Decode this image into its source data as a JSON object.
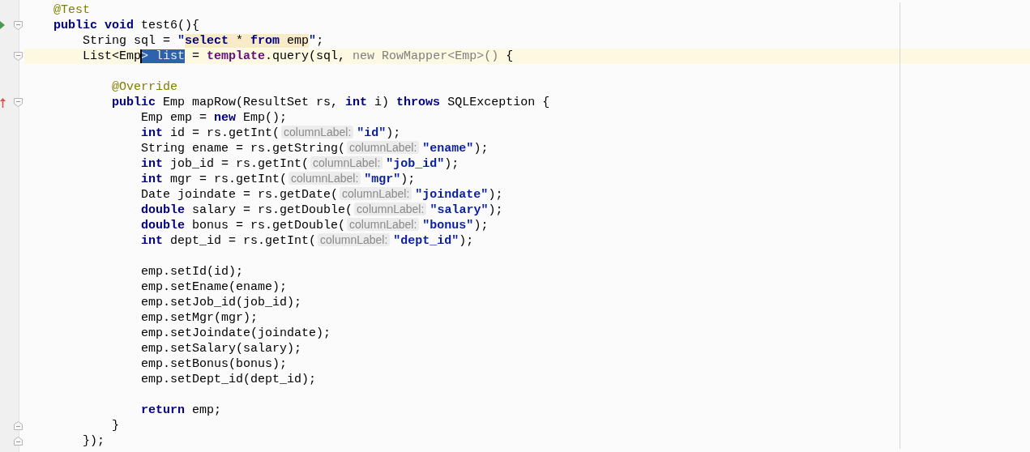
{
  "editor": {
    "lines": [
      {
        "current": false,
        "tokens": [
          {
            "kind": "annotation",
            "text": "    @Test"
          }
        ]
      },
      {
        "gutter": [
          {
            "kind": "run"
          },
          {
            "kind": "fold-start"
          }
        ],
        "current": false,
        "tokens": [
          {
            "kind": "keyword",
            "text": "    public void "
          },
          {
            "kind": "plain",
            "text": "test6(){"
          }
        ]
      },
      {
        "current": false,
        "tokens": [
          {
            "kind": "plain",
            "text": "        String sql = "
          },
          {
            "kind": "string",
            "text": "\""
          },
          {
            "kind": "sql-keyword",
            "text": "select"
          },
          {
            "kind": "sql-text",
            "text": " * "
          },
          {
            "kind": "sql-keyword",
            "text": "from"
          },
          {
            "kind": "sql-text",
            "text": " emp"
          },
          {
            "kind": "string",
            "text": "\""
          },
          {
            "kind": "plain",
            "text": ";"
          }
        ]
      },
      {
        "gutter": [
          {
            "kind": "fold-start"
          }
        ],
        "current": true,
        "tokens": [
          {
            "kind": "plain",
            "text": "        List<Emp"
          },
          {
            "kind": "selection",
            "text": "> list",
            "caret": true
          },
          {
            "kind": "plain",
            "text": " = "
          },
          {
            "kind": "field",
            "text": "template"
          },
          {
            "kind": "plain",
            "text": ".query(sql, "
          },
          {
            "kind": "unused",
            "text": "new RowMapper<Emp>()"
          },
          {
            "kind": "plain",
            "text": " {"
          }
        ]
      },
      {
        "current": false
      },
      {
        "current": false,
        "tokens": [
          {
            "kind": "annotation",
            "text": "            @Override"
          }
        ]
      },
      {
        "gutter": [
          {
            "kind": "override"
          },
          {
            "kind": "fold-start"
          }
        ],
        "current": false,
        "tokens": [
          {
            "kind": "keyword",
            "text": "            public "
          },
          {
            "kind": "plain",
            "text": "Emp mapRow(ResultSet rs, "
          },
          {
            "kind": "keyword",
            "text": "int "
          },
          {
            "kind": "plain",
            "text": "i) "
          },
          {
            "kind": "keyword",
            "text": "throws "
          },
          {
            "kind": "plain",
            "text": "SQLException {"
          }
        ]
      },
      {
        "current": false,
        "tokens": [
          {
            "kind": "plain",
            "text": "                Emp emp = "
          },
          {
            "kind": "keyword",
            "text": "new "
          },
          {
            "kind": "plain",
            "text": "Emp();"
          }
        ]
      },
      {
        "current": false,
        "tokens": [
          {
            "kind": "keyword",
            "text": "                int "
          },
          {
            "kind": "plain",
            "text": "id = rs.getInt("
          },
          {
            "kind": "hint",
            "text": "columnLabel:"
          },
          {
            "kind": "string",
            "text": "\"id\""
          },
          {
            "kind": "plain",
            "text": ");"
          }
        ]
      },
      {
        "current": false,
        "tokens": [
          {
            "kind": "plain",
            "text": "                String ename = rs.getString("
          },
          {
            "kind": "hint",
            "text": "columnLabel:"
          },
          {
            "kind": "string",
            "text": "\"ename\""
          },
          {
            "kind": "plain",
            "text": ");"
          }
        ]
      },
      {
        "current": false,
        "tokens": [
          {
            "kind": "keyword",
            "text": "                int "
          },
          {
            "kind": "plain",
            "text": "job_id = rs.getInt("
          },
          {
            "kind": "hint",
            "text": "columnLabel:"
          },
          {
            "kind": "string",
            "text": "\"job_id\""
          },
          {
            "kind": "plain",
            "text": ");"
          }
        ]
      },
      {
        "current": false,
        "tokens": [
          {
            "kind": "keyword",
            "text": "                int "
          },
          {
            "kind": "plain",
            "text": "mgr = rs.getInt("
          },
          {
            "kind": "hint",
            "text": "columnLabel:"
          },
          {
            "kind": "string",
            "text": "\"mgr\""
          },
          {
            "kind": "plain",
            "text": ");"
          }
        ]
      },
      {
        "current": false,
        "tokens": [
          {
            "kind": "plain",
            "text": "                Date joindate = rs.getDate("
          },
          {
            "kind": "hint",
            "text": "columnLabel:"
          },
          {
            "kind": "string",
            "text": "\"joindate\""
          },
          {
            "kind": "plain",
            "text": ");"
          }
        ]
      },
      {
        "current": false,
        "tokens": [
          {
            "kind": "keyword",
            "text": "                double "
          },
          {
            "kind": "plain",
            "text": "salary = rs.getDouble("
          },
          {
            "kind": "hint",
            "text": "columnLabel:"
          },
          {
            "kind": "string",
            "text": "\"salary\""
          },
          {
            "kind": "plain",
            "text": ");"
          }
        ]
      },
      {
        "current": false,
        "tokens": [
          {
            "kind": "keyword",
            "text": "                double "
          },
          {
            "kind": "plain",
            "text": "bonus = rs.getDouble("
          },
          {
            "kind": "hint",
            "text": "columnLabel:"
          },
          {
            "kind": "string",
            "text": "\"bonus\""
          },
          {
            "kind": "plain",
            "text": ");"
          }
        ]
      },
      {
        "current": false,
        "tokens": [
          {
            "kind": "keyword",
            "text": "                int "
          },
          {
            "kind": "plain",
            "text": "dept_id = rs.getInt("
          },
          {
            "kind": "hint",
            "text": "columnLabel:"
          },
          {
            "kind": "string",
            "text": "\"dept_id\""
          },
          {
            "kind": "plain",
            "text": ");"
          }
        ]
      },
      {
        "current": false
      },
      {
        "current": false,
        "tokens": [
          {
            "kind": "plain",
            "text": "                emp.setId(id);"
          }
        ]
      },
      {
        "current": false,
        "tokens": [
          {
            "kind": "plain",
            "text": "                emp.setEname(ename);"
          }
        ]
      },
      {
        "current": false,
        "tokens": [
          {
            "kind": "plain",
            "text": "                emp.setJob_id(job_id);"
          }
        ]
      },
      {
        "current": false,
        "tokens": [
          {
            "kind": "plain",
            "text": "                emp.setMgr(mgr);"
          }
        ]
      },
      {
        "current": false,
        "tokens": [
          {
            "kind": "plain",
            "text": "                emp.setJoindate(joindate);"
          }
        ]
      },
      {
        "current": false,
        "tokens": [
          {
            "kind": "plain",
            "text": "                emp.setSalary(salary);"
          }
        ]
      },
      {
        "current": false,
        "tokens": [
          {
            "kind": "plain",
            "text": "                emp.setBonus(bonus);"
          }
        ]
      },
      {
        "current": false,
        "tokens": [
          {
            "kind": "plain",
            "text": "                emp.setDept_id(dept_id);"
          }
        ]
      },
      {
        "current": false
      },
      {
        "current": false,
        "tokens": [
          {
            "kind": "keyword",
            "text": "                return "
          },
          {
            "kind": "plain",
            "text": "emp;"
          }
        ]
      },
      {
        "gutter": [
          {
            "kind": "fold-end"
          }
        ],
        "current": false,
        "tokens": [
          {
            "kind": "plain",
            "text": "            }"
          }
        ]
      },
      {
        "gutter": [
          {
            "kind": "fold-end"
          }
        ],
        "current": false,
        "tokens": [
          {
            "kind": "plain",
            "text": "        });"
          }
        ]
      }
    ]
  }
}
